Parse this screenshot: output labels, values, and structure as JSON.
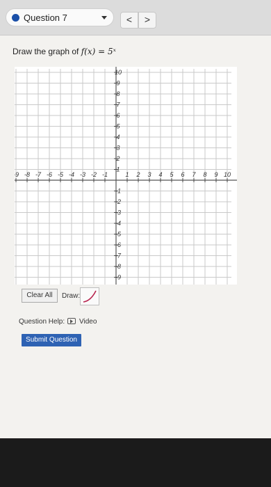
{
  "header": {
    "question_label": "Question 7",
    "prev_label": "<",
    "next_label": ">",
    "caret_icon": "chevron-down-icon",
    "status_color": "#1a4fa8"
  },
  "prompt": {
    "text": "Draw the graph of ",
    "math": "f(x) = 5ˣ"
  },
  "graph": {
    "x_ticks": [
      -10,
      -9,
      -8,
      -7,
      -6,
      -5,
      -4,
      -3,
      -2,
      -1,
      1,
      2,
      3,
      4,
      5,
      6,
      7,
      8,
      9,
      10
    ],
    "y_ticks": [
      10,
      9,
      8,
      7,
      6,
      5,
      4,
      3,
      2,
      1,
      -1,
      -2,
      -3,
      -4,
      -5,
      -6,
      -7,
      -8,
      -9,
      -10
    ],
    "xlim": [
      -10,
      10
    ],
    "ylim": [
      -10,
      10
    ],
    "grid": true
  },
  "controls": {
    "clear_label": "Clear All",
    "draw_label": "Draw:",
    "draw_tool_icon": "curve-pen-icon",
    "curve_color": "#b8254f"
  },
  "help": {
    "label": "Question Help:",
    "video_icon": "video-icon",
    "video_label": "Video"
  },
  "submit": {
    "label": "Submit Question",
    "color": "#2e62b3"
  }
}
